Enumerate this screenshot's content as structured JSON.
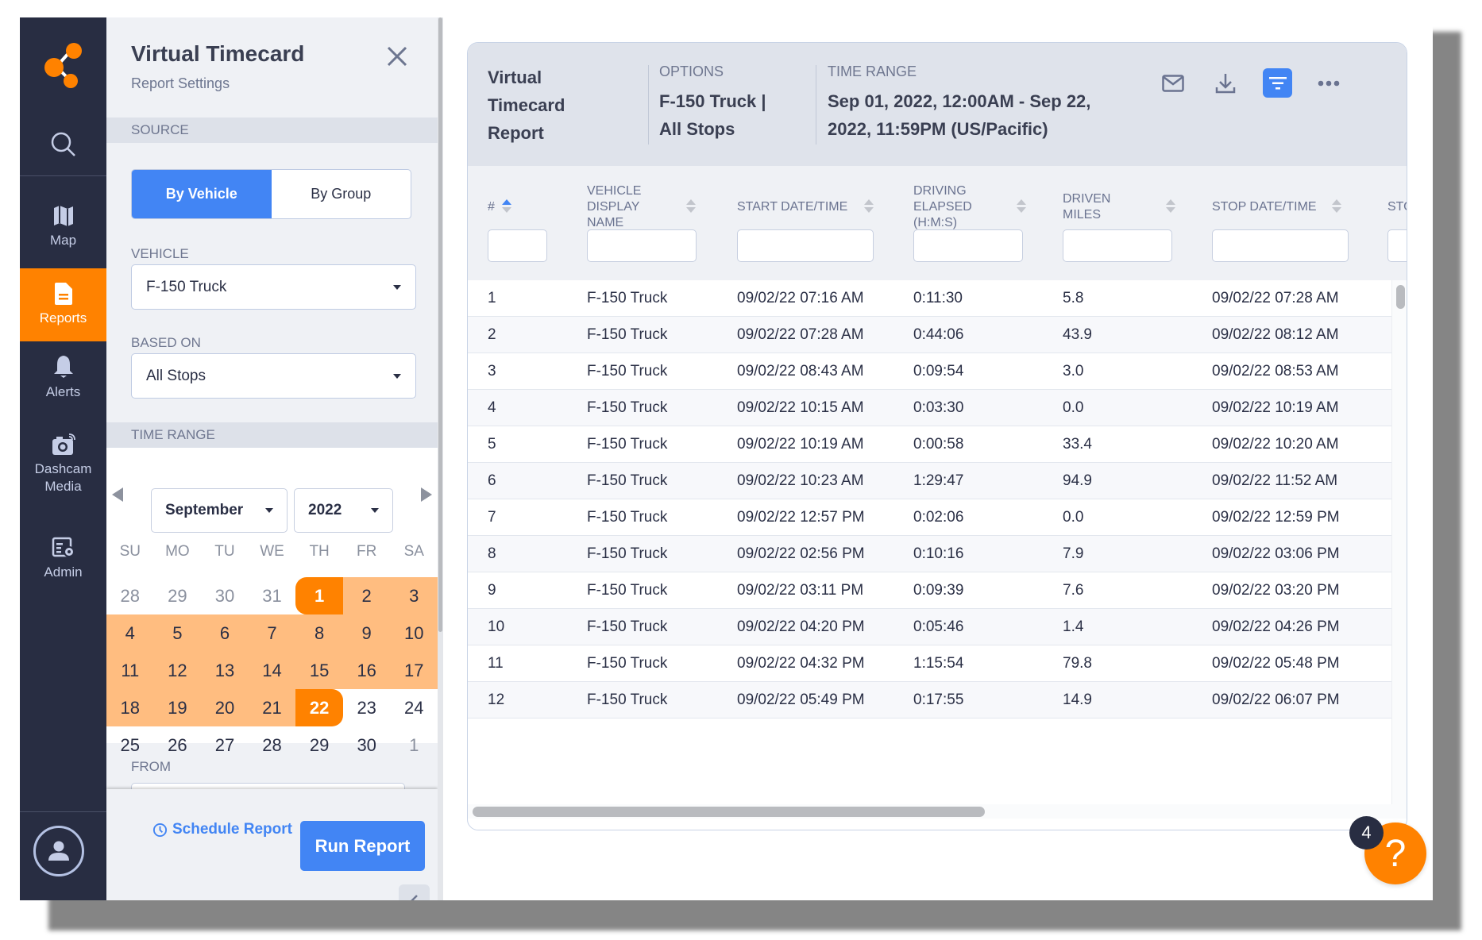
{
  "sidebar": {
    "logo": "share-nodes-logo",
    "search_icon": "search-icon",
    "items": [
      {
        "label": "Map",
        "icon": "map-icon",
        "active": false
      },
      {
        "label": "Reports",
        "icon": "document-icon",
        "active": true
      },
      {
        "label": "Alerts",
        "icon": "bell-icon",
        "active": false
      },
      {
        "label": "Dashcam Media",
        "icon": "camera-icon",
        "active": false
      },
      {
        "label": "Admin",
        "icon": "admin-settings-icon",
        "active": false
      }
    ],
    "user_icon": "user-avatar-icon"
  },
  "settings": {
    "title": "Virtual Timecard",
    "subtitle": "Report Settings",
    "source_label": "SOURCE",
    "source_options": [
      "By Vehicle",
      "By Group"
    ],
    "source_selected": "By Vehicle",
    "vehicle_label": "VEHICLE",
    "vehicle_value": "F-150 Truck",
    "based_on_label": "BASED ON",
    "based_on_value": "All Stops",
    "time_range_label": "TIME RANGE",
    "calendar": {
      "month": "September",
      "year": "2022",
      "weekdays": [
        "SU",
        "MO",
        "TU",
        "WE",
        "TH",
        "FR",
        "SA"
      ],
      "weeks": [
        [
          {
            "d": "28",
            "m": true
          },
          {
            "d": "29",
            "m": true
          },
          {
            "d": "30",
            "m": true
          },
          {
            "d": "31",
            "m": true
          },
          {
            "d": "1",
            "s": "start"
          },
          {
            "d": "2",
            "s": "in"
          },
          {
            "d": "3",
            "s": "in"
          }
        ],
        [
          {
            "d": "4",
            "s": "in"
          },
          {
            "d": "5",
            "s": "in"
          },
          {
            "d": "6",
            "s": "in"
          },
          {
            "d": "7",
            "s": "in"
          },
          {
            "d": "8",
            "s": "in"
          },
          {
            "d": "9",
            "s": "in"
          },
          {
            "d": "10",
            "s": "in"
          }
        ],
        [
          {
            "d": "11",
            "s": "in"
          },
          {
            "d": "12",
            "s": "in"
          },
          {
            "d": "13",
            "s": "in"
          },
          {
            "d": "14",
            "s": "in"
          },
          {
            "d": "15",
            "s": "in"
          },
          {
            "d": "16",
            "s": "in"
          },
          {
            "d": "17",
            "s": "in"
          }
        ],
        [
          {
            "d": "18",
            "s": "in"
          },
          {
            "d": "19",
            "s": "in"
          },
          {
            "d": "20",
            "s": "in"
          },
          {
            "d": "21",
            "s": "in"
          },
          {
            "d": "22",
            "s": "end"
          },
          {
            "d": "23"
          },
          {
            "d": "24"
          }
        ],
        [
          {
            "d": "25"
          },
          {
            "d": "26"
          },
          {
            "d": "27"
          },
          {
            "d": "28"
          },
          {
            "d": "29"
          },
          {
            "d": "30"
          },
          {
            "d": "1",
            "m": true
          }
        ]
      ],
      "range_start": "Sep 1",
      "range_end": "Sep 22"
    },
    "from_label": "FROM",
    "schedule_label": "Schedule Report",
    "run_label": "Run Report"
  },
  "report": {
    "title": "Virtual Timecard Report",
    "options_label": "OPTIONS",
    "options_value": "F-150 Truck | All Stops",
    "time_range_label": "TIME RANGE",
    "time_range_value": "Sep 01, 2022, 12:00AM - Sep 22, 2022, 11:59PM (US/Pacific)",
    "actions": [
      "email-icon",
      "download-icon",
      "filter-icon",
      "more-icon"
    ],
    "columns": [
      {
        "label": "#",
        "sort": "asc"
      },
      {
        "label": "VEHICLE DISPLAY NAME",
        "sort": "none"
      },
      {
        "label": "START DATE/TIME",
        "sort": "none"
      },
      {
        "label": "DRIVING ELAPSED (H:M:S)",
        "sort": "none"
      },
      {
        "label": "DRIVEN MILES",
        "sort": "none"
      },
      {
        "label": "STOP DATE/TIME",
        "sort": "none"
      },
      {
        "label": "STO",
        "sort": "none"
      }
    ],
    "rows": [
      [
        "1",
        "F-150 Truck",
        "09/02/22 07:16 AM",
        "0:11:30",
        "5.8",
        "09/02/22 07:28 AM"
      ],
      [
        "2",
        "F-150 Truck",
        "09/02/22 07:28 AM",
        "0:44:06",
        "43.9",
        "09/02/22 08:12 AM"
      ],
      [
        "3",
        "F-150 Truck",
        "09/02/22 08:43 AM",
        "0:09:54",
        "3.0",
        "09/02/22 08:53 AM"
      ],
      [
        "4",
        "F-150 Truck",
        "09/02/22 10:15 AM",
        "0:03:30",
        "0.0",
        "09/02/22 10:19 AM"
      ],
      [
        "5",
        "F-150 Truck",
        "09/02/22 10:19 AM",
        "0:00:58",
        "33.4",
        "09/02/22 10:20 AM"
      ],
      [
        "6",
        "F-150 Truck",
        "09/02/22 10:23 AM",
        "1:29:47",
        "94.9",
        "09/02/22 11:52 AM"
      ],
      [
        "7",
        "F-150 Truck",
        "09/02/22 12:57 PM",
        "0:02:06",
        "0.0",
        "09/02/22 12:59 PM"
      ],
      [
        "8",
        "F-150 Truck",
        "09/02/22 02:56 PM",
        "0:10:16",
        "7.9",
        "09/02/22 03:06 PM"
      ],
      [
        "9",
        "F-150 Truck",
        "09/02/22 03:11 PM",
        "0:09:39",
        "7.6",
        "09/02/22 03:20 PM"
      ],
      [
        "10",
        "F-150 Truck",
        "09/02/22 04:20 PM",
        "0:05:46",
        "1.4",
        "09/02/22 04:26 PM"
      ],
      [
        "11",
        "F-150 Truck",
        "09/02/22 04:32 PM",
        "1:15:54",
        "79.8",
        "09/02/22 05:48 PM"
      ],
      [
        "12",
        "F-150 Truck",
        "09/02/22 05:49 PM",
        "0:17:55",
        "14.9",
        "09/02/22 06:07 PM"
      ]
    ]
  },
  "help": {
    "icon": "question-icon",
    "symbol": "?",
    "badge_count": "4"
  },
  "colors": {
    "accent_orange": "#ff8200",
    "range_orange": "#ffbd80",
    "primary_blue": "#4285f4",
    "sidebar_bg": "#282d42"
  }
}
